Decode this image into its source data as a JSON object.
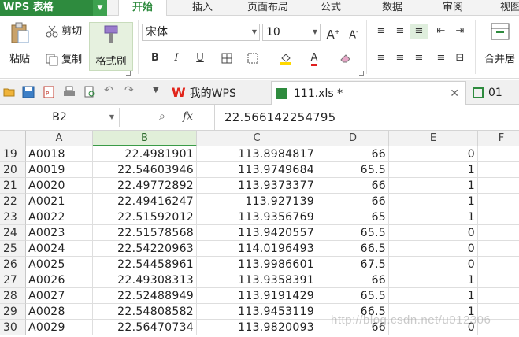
{
  "app": {
    "name": "WPS 表格"
  },
  "menu_tabs": [
    "开始",
    "插入",
    "页面布局",
    "公式",
    "数据",
    "审阅",
    "视图"
  ],
  "ribbon": {
    "paste": "粘贴",
    "cut": "剪切",
    "copy": "复制",
    "format_painter": "格式刷",
    "font_name": "宋体",
    "font_size": "10",
    "bold": "B",
    "italic": "I",
    "underline": "U",
    "merge": "合并居"
  },
  "doc_tabs": {
    "home": "我的WPS",
    "active": "111.xls *",
    "other": "01"
  },
  "formula_bar": {
    "name_box": "B2",
    "fx": "fx",
    "value": "22.566142254795"
  },
  "columns": [
    "A",
    "B",
    "C",
    "D",
    "E",
    "F"
  ],
  "rows": [
    {
      "n": "19",
      "a": "A0018",
      "b": "22.4981901",
      "c": "113.8984817",
      "d": "66",
      "e": "0"
    },
    {
      "n": "20",
      "a": "A0019",
      "b": "22.54603946",
      "c": "113.9749684",
      "d": "65.5",
      "e": "1"
    },
    {
      "n": "21",
      "a": "A0020",
      "b": "22.49772892",
      "c": "113.9373377",
      "d": "66",
      "e": "1"
    },
    {
      "n": "22",
      "a": "A0021",
      "b": "22.49416247",
      "c": "113.927139",
      "d": "66",
      "e": "1"
    },
    {
      "n": "23",
      "a": "A0022",
      "b": "22.51592012",
      "c": "113.9356769",
      "d": "65",
      "e": "1"
    },
    {
      "n": "24",
      "a": "A0023",
      "b": "22.51578568",
      "c": "113.9420557",
      "d": "65.5",
      "e": "0"
    },
    {
      "n": "25",
      "a": "A0024",
      "b": "22.54220963",
      "c": "114.0196493",
      "d": "66.5",
      "e": "0"
    },
    {
      "n": "26",
      "a": "A0025",
      "b": "22.54458961",
      "c": "113.9986601",
      "d": "67.5",
      "e": "0"
    },
    {
      "n": "27",
      "a": "A0026",
      "b": "22.49308313",
      "c": "113.9358391",
      "d": "66",
      "e": "1"
    },
    {
      "n": "28",
      "a": "A0027",
      "b": "22.52488949",
      "c": "113.9191429",
      "d": "65.5",
      "e": "1"
    },
    {
      "n": "29",
      "a": "A0028",
      "b": "22.54808582",
      "c": "113.9453119",
      "d": "66.5",
      "e": "1"
    },
    {
      "n": "30",
      "a": "A0029",
      "b": "22.56470734",
      "c": "113.9820093",
      "d": "66",
      "e": "0"
    }
  ],
  "watermark": "http://blog.csdn.net/u012306",
  "colors": {
    "accent": "#2e8b3e",
    "selected_col": "#e1efd9"
  },
  "selected_column": "B"
}
